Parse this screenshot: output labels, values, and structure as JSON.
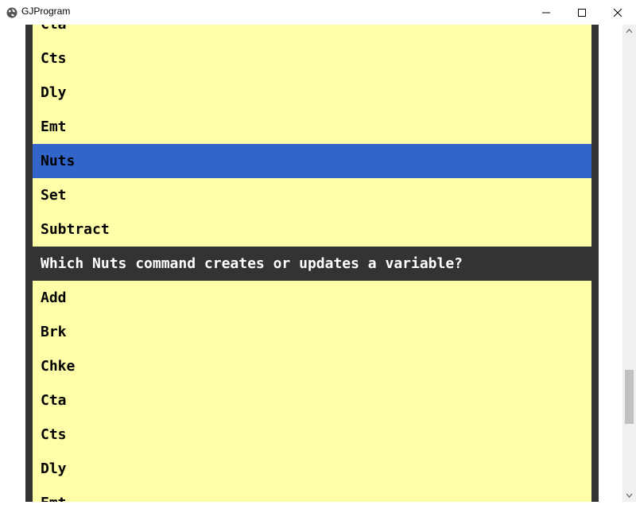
{
  "window": {
    "title": "GJProgram",
    "icon": "globe-icon",
    "controls": [
      "minimize-icon",
      "maximize-icon",
      "close-icon"
    ]
  },
  "list": {
    "rows": [
      {
        "text": "Cta",
        "kind": "option"
      },
      {
        "text": "Cts",
        "kind": "option"
      },
      {
        "text": "Dly",
        "kind": "option"
      },
      {
        "text": "Emt",
        "kind": "option"
      },
      {
        "text": "Nuts",
        "kind": "selected"
      },
      {
        "text": "Set",
        "kind": "option"
      },
      {
        "text": "Subtract",
        "kind": "option"
      },
      {
        "text": "Which Nuts command creates or updates a variable?",
        "kind": "question"
      },
      {
        "text": "Add",
        "kind": "option"
      },
      {
        "text": "Brk",
        "kind": "option"
      },
      {
        "text": "Chke",
        "kind": "option"
      },
      {
        "text": "Cta",
        "kind": "option"
      },
      {
        "text": "Cts",
        "kind": "option"
      },
      {
        "text": "Dly",
        "kind": "option"
      },
      {
        "text": "Emt",
        "kind": "option"
      }
    ]
  },
  "colors": {
    "option_bg": "#fffea8",
    "selected_bg": "#3265c9",
    "question_bg": "#333333",
    "question_fg": "#ffffff"
  }
}
